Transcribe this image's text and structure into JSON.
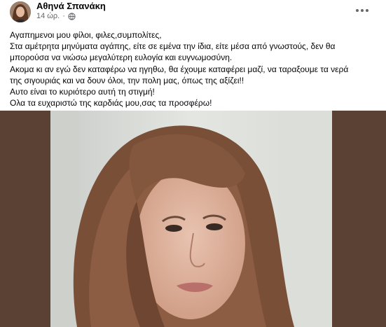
{
  "post": {
    "author": "Αθηνά Σπανάκη",
    "time": "14 ώρ.",
    "audience_icon": "globe-icon",
    "more_icon": "more-options-icon",
    "lines": [
      "Αγαπημενοι μου  φίλοι, φιλες,συμπολίτες,",
      "Στα αμέτρητα μηνύματα αγάπης, είτε σε εμένα την ίδια, είτε μέσα από γνωστούς, δεν θα",
      "μπορούσα να νιώσω μεγαλύτερη ευλογία και ευγνωμοσύνη.",
      "Ακομα κι αν εγώ δεν καταφέρω να ηγηθω, θα έχουμε καταφέρει μαζί, να ταραξουμε τα νερά",
      "της σιγουριάς και να δουν όλοι, την πολη μας, όπως της αξίζει!!",
      "Αυτο είναι το κυριότερο αυτή τη στιγμή!",
      "Ολα τα ευχαριστώ της καρδιάς μου,σας τα προσφέρω!"
    ]
  },
  "colors": {
    "author_text": "#050505",
    "meta_text": "#65676b",
    "media_frame": "#5b4134"
  }
}
